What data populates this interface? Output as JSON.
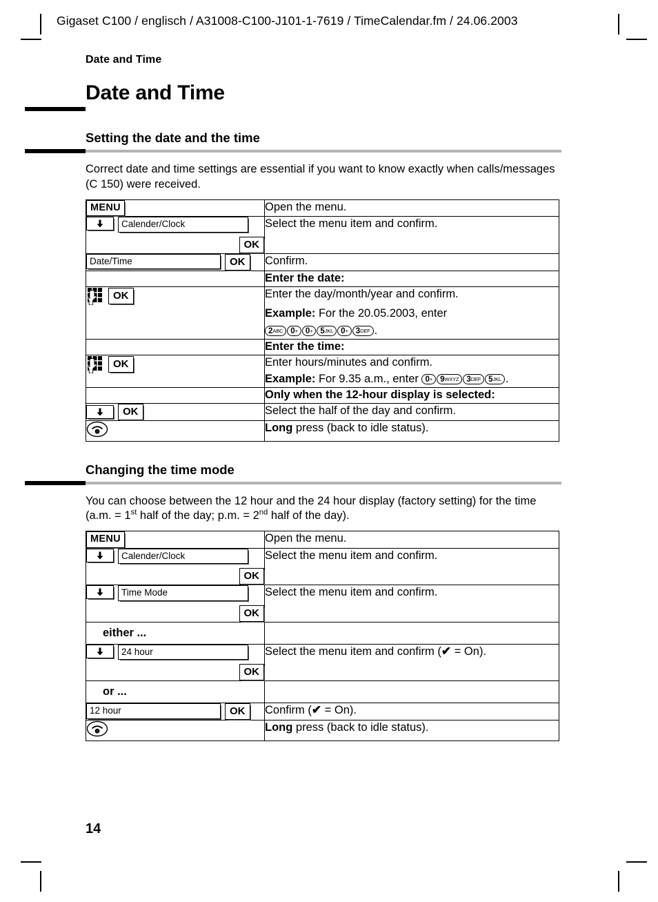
{
  "document": {
    "header_line": "Gigaset C100 / englisch / A31008-C100-J101-1-7619 / TimeCalendar.fm / 24.06.2003",
    "running_title": "Date and Time",
    "chapter_title": "Date and Time",
    "page_number": "14"
  },
  "section_setting": {
    "heading": "Setting the date and the time",
    "intro": "Correct date and time settings are essential if you want to know exactly when calls/messages (C 150) were received.",
    "rows": [
      {
        "key_kind": "menu",
        "menu_label": "MENU",
        "desc": "Open the menu."
      },
      {
        "key_kind": "arrow-list-ok",
        "list_label": "Calender/Clock",
        "ok_label": "OK",
        "desc": "Select the menu item and confirm."
      },
      {
        "key_kind": "list-ok-inline",
        "list_label": "Date/Time",
        "ok_label": "OK",
        "desc": "Confirm."
      },
      {
        "key_kind": "none",
        "desc_bold": "Enter the date:"
      },
      {
        "key_kind": "keypad-ok",
        "ok_label": "OK",
        "desc": "Enter the day/month/year and confirm.",
        "example_label": "Example:",
        "example_text": "For the 20.05.2003, enter",
        "example_keys": [
          {
            "num": "2",
            "sub": "ABC"
          },
          {
            "num": "0",
            "sub": "+"
          },
          {
            "num": "0",
            "sub": "+"
          },
          {
            "num": "5",
            "sub": "JKL"
          },
          {
            "num": "0",
            "sub": "+"
          },
          {
            "num": "3",
            "sub": "DEF"
          }
        ],
        "example_tail": "."
      },
      {
        "key_kind": "none",
        "desc_bold": "Enter the time:"
      },
      {
        "key_kind": "keypad-ok",
        "ok_label": "OK",
        "desc": "Enter hours/minutes and confirm.",
        "example_label": "Example:",
        "example_text": "For 9.35 a.m., enter",
        "example_keys": [
          {
            "num": "0",
            "sub": "+"
          },
          {
            "num": "9",
            "sub": "WXYZ"
          },
          {
            "num": "3",
            "sub": "DEF"
          },
          {
            "num": "5",
            "sub": "JKL"
          }
        ],
        "example_tail": ".",
        "example_inline": true
      },
      {
        "key_kind": "none",
        "desc_bold": "Only when the 12-hour display is selected:"
      },
      {
        "key_kind": "arrow-ok",
        "ok_label": "OK",
        "desc": "Select the half of the day and confirm."
      },
      {
        "key_kind": "endcall",
        "desc_lead": "Long",
        "desc_rest": " press (back to idle status)."
      }
    ]
  },
  "section_timemode": {
    "heading": "Changing the time mode",
    "intro_part1": "You can choose between the 12 hour and the 24 hour display (factory setting) for the time (a.m. = 1",
    "intro_sup1": "st",
    "intro_part2": " half of the day; p.m. = 2",
    "intro_sup2": "nd",
    "intro_part3": " half of the day).",
    "rows": [
      {
        "key_kind": "menu",
        "menu_label": "MENU",
        "desc": "Open the menu."
      },
      {
        "key_kind": "arrow-list-ok",
        "list_label": "Calender/Clock",
        "ok_label": "OK",
        "desc": "Select the menu item and confirm."
      },
      {
        "key_kind": "arrow-list-ok",
        "list_label": "Time Mode",
        "ok_label": "OK",
        "desc": "Select the menu item and confirm."
      },
      {
        "key_kind": "note",
        "note": "either ...",
        "desc": ""
      },
      {
        "key_kind": "arrow-list-ok",
        "list_label": "24 hour",
        "ok_label": "OK",
        "desc_pre": "Select the menu item and confirm (",
        "desc_check": "✔",
        "desc_post": " = On)."
      },
      {
        "key_kind": "note",
        "note": "or ...",
        "desc": ""
      },
      {
        "key_kind": "list-ok-inline",
        "list_label": "12 hour",
        "ok_label": "OK",
        "desc_pre": "Confirm (",
        "desc_check": "✔",
        "desc_post": " = On)."
      },
      {
        "key_kind": "endcall",
        "desc_lead": "Long",
        "desc_rest": " press (back to idle status)."
      }
    ]
  },
  "icons": {
    "keypad": "keypad-icon",
    "arrow_down": "arrow-down-icon",
    "end_call": "end-call-icon"
  }
}
